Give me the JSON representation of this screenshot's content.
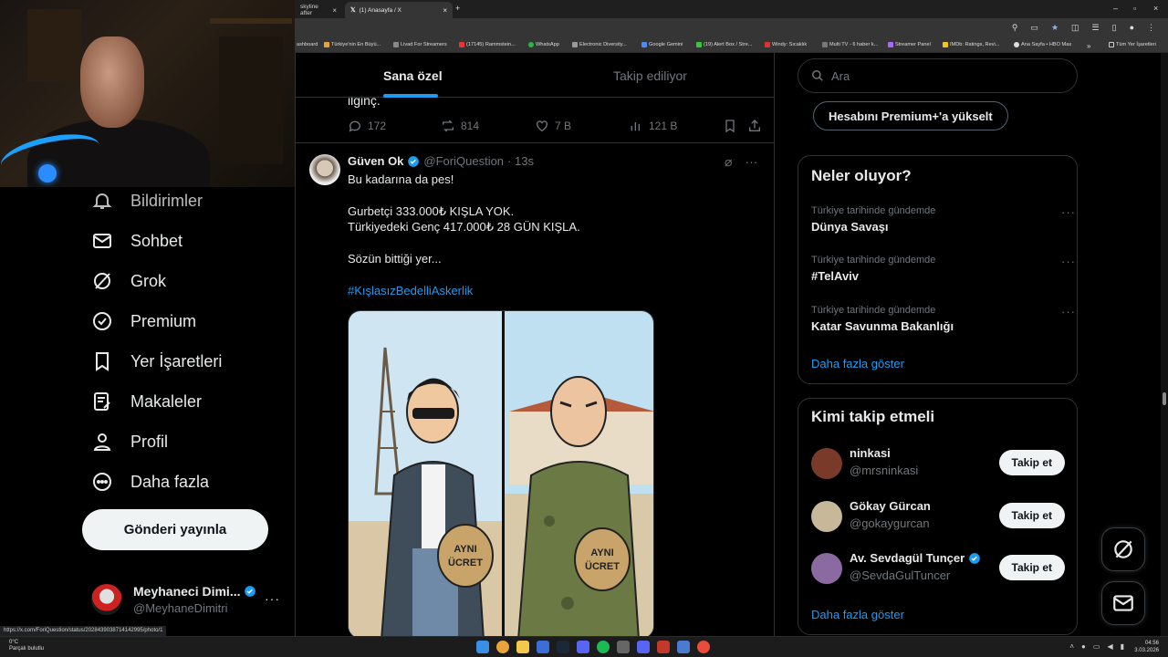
{
  "browser": {
    "tabs": [
      {
        "label": "skyline after",
        "active": false
      },
      {
        "label": "(1) Anasayfa / X",
        "active": true
      }
    ],
    "new_tab": "+",
    "bookmarks": [
      "ashboard",
      "Türkiye'nin En Büyü...",
      "Livad For Streamers",
      "(17145) Rammstein...",
      "WhatsApp",
      "Electronic Diversity...",
      "Google Gemini",
      "(19) Alert Box / Stre...",
      "Windy: Sıcaklık",
      "Multi TV - 6 haber k...",
      "Streamer Panel",
      "IMDb: Ratings, Revi...",
      "Ana Sayfa • HBO Max",
      "Tüm Yer İşaretleri"
    ],
    "status_url": "https://x.com/ForiQuestion/status/2028439038714142995/photo/1"
  },
  "nav": {
    "items": [
      {
        "label": "Bildirimler",
        "icon": "bell-icon"
      },
      {
        "label": "Sohbet",
        "icon": "mail-icon"
      },
      {
        "label": "Grok",
        "icon": "grok-icon"
      },
      {
        "label": "Premium",
        "icon": "verified-icon"
      },
      {
        "label": "Yer İşaretleri",
        "icon": "bookmark-icon"
      },
      {
        "label": "Makaleler",
        "icon": "article-icon"
      },
      {
        "label": "Profil",
        "icon": "person-icon"
      },
      {
        "label": "Daha fazla",
        "icon": "more-circle-icon"
      }
    ],
    "post_button": "Gönderi yayınla",
    "account": {
      "name": "Meyhaneci Dimi...",
      "handle": "@MeyhaneDimitri"
    }
  },
  "timeline": {
    "tabs": [
      "Sana özel",
      "Takip ediliyor"
    ],
    "previous": {
      "text_tail": "ilginç.",
      "replies": "172",
      "reposts": "814",
      "likes": "7 B",
      "views": "121 B"
    },
    "tweet": {
      "name": "Güven Ok",
      "handle": "@ForiQuestion",
      "time": "· 13s",
      "lines": [
        "Bu kadarına da pes!",
        "Gurbetçi 333.000₺ KIŞLA YOK.",
        "Türkiyedeki Genç 417.000₺ 28 GÜN KIŞLA.",
        "Sözün bittiği yer..."
      ],
      "hashtag": "#KışlasızBedelliAskerlik",
      "image_bag_text_line1": "AYNI",
      "image_bag_text_line2": "ÜCRET"
    }
  },
  "sidebar": {
    "search_placeholder": "Ara",
    "premium_button": "Hesabını Premium+'a yükselt",
    "trends_title": "Neler oluyor?",
    "trends": [
      {
        "context": "Türkiye tarihinde gündemde",
        "title": "Dünya Savaşı"
      },
      {
        "context": "Türkiye tarihinde gündemde",
        "title": "#TelAviv"
      },
      {
        "context": "Türkiye tarihinde gündemde",
        "title": "Katar Savunma Bakanlığı"
      }
    ],
    "show_more": "Daha fazla göster",
    "who_title": "Kimi takip etmeli",
    "who": [
      {
        "name": "ninkasi",
        "handle": "@mrsninkasi",
        "verified": false,
        "avatar_color": "#7a3a2a"
      },
      {
        "name": "Gökay Gürcan",
        "handle": "@gokaygurcan",
        "verified": false,
        "avatar_color": "#c8b89a"
      },
      {
        "name": "Av. Sevdagül Tunçer",
        "handle": "@SevdaGulTuncer",
        "verified": true,
        "avatar_color": "#8a6aa0"
      }
    ],
    "follow_label": "Takip et"
  },
  "taskbar": {
    "weather_temp": "0°C",
    "weather_desc": "Parçalı bulutlu",
    "time": "04:56",
    "date": "3.03.2026"
  },
  "colors": {
    "accent": "#1d9bf0",
    "border": "#2f3336",
    "muted": "#71767b"
  }
}
